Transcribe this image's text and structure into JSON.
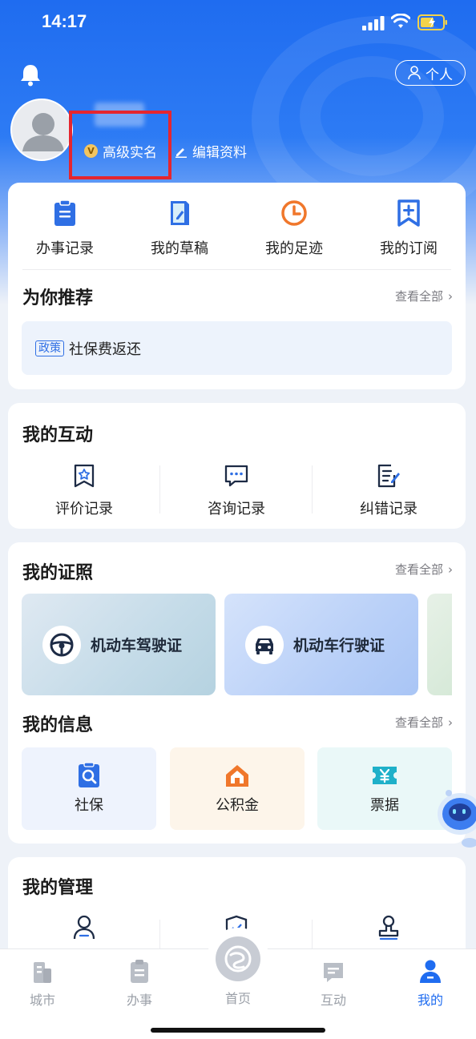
{
  "status_bar": {
    "time": "14:17"
  },
  "header": {
    "personal_label": "个人",
    "verification_label": "高级实名",
    "verification_badge": "V",
    "edit_label": "编辑资料"
  },
  "quick_actions": [
    {
      "label": "办事记录",
      "icon": "clipboard-icon"
    },
    {
      "label": "我的草稿",
      "icon": "draft-icon"
    },
    {
      "label": "我的足迹",
      "icon": "clock-icon"
    },
    {
      "label": "我的订阅",
      "icon": "bookmark-plus-icon"
    }
  ],
  "recommend": {
    "title": "为你推荐",
    "see_all": "查看全部",
    "tag": "政策",
    "item": "社保费返还"
  },
  "interaction": {
    "title": "我的互动",
    "items": [
      {
        "label": "评价记录",
        "icon": "star-bookmark-icon"
      },
      {
        "label": "咨询记录",
        "icon": "chat-bubble-icon"
      },
      {
        "label": "纠错记录",
        "icon": "edit-document-icon"
      }
    ]
  },
  "licenses": {
    "title": "我的证照",
    "see_all": "查看全部",
    "items": [
      {
        "label": "机动车驾驶证",
        "icon": "steering-wheel-icon"
      },
      {
        "label": "机动车行驶证",
        "icon": "car-icon"
      }
    ]
  },
  "info": {
    "title": "我的信息",
    "see_all": "查看全部",
    "items": [
      {
        "label": "社保",
        "icon": "social-security-icon"
      },
      {
        "label": "公积金",
        "icon": "house-icon"
      },
      {
        "label": "票据",
        "icon": "ticket-icon"
      }
    ]
  },
  "management": {
    "title": "我的管理"
  },
  "tabbar": {
    "items": [
      {
        "label": "城市",
        "icon": "city-icon"
      },
      {
        "label": "办事",
        "icon": "service-icon"
      },
      {
        "label": "首页",
        "icon": "home-logo-icon"
      },
      {
        "label": "互动",
        "icon": "interaction-icon"
      },
      {
        "label": "我的",
        "icon": "profile-icon"
      }
    ],
    "active": "我的"
  },
  "colors": {
    "brand_blue": "#1f6cf0",
    "highlight_red": "#e5262f",
    "orange": "#f0772b",
    "tab_inactive": "#9ba0a8"
  }
}
